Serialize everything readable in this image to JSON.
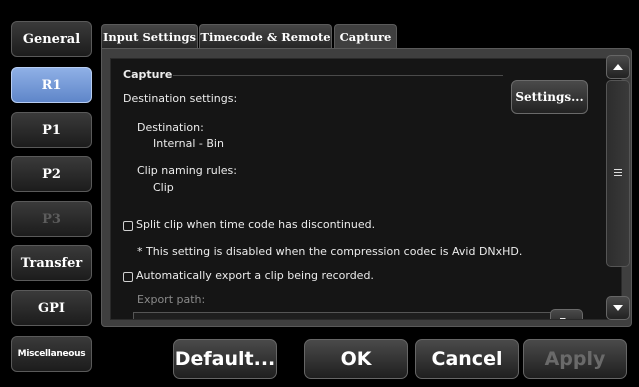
{
  "sidebar": {
    "items": [
      {
        "label": "General"
      },
      {
        "label": "R1"
      },
      {
        "label": "P1"
      },
      {
        "label": "P2"
      },
      {
        "label": "P3"
      },
      {
        "label": "Transfer"
      },
      {
        "label": "GPI"
      },
      {
        "label": "Miscellaneous"
      }
    ]
  },
  "tabs": [
    {
      "label": "Input Settings"
    },
    {
      "label": "Timecode & Remote"
    },
    {
      "label": "Capture"
    }
  ],
  "capture": {
    "group_title": "Capture",
    "destination_settings_label": "Destination settings:",
    "settings_button": "Settings...",
    "destination_label": "Destination:",
    "destination_value": "Internal - Bin",
    "clip_naming_label": "Clip naming rules:",
    "clip_naming_value": "Clip",
    "split_clip_label": "Split clip when time code has discontinued.",
    "split_clip_checked": false,
    "dnxhd_note": "* This setting is disabled when the compression codec is Avid DNxHD.",
    "auto_export_label": "Automatically export a clip being recorded.",
    "auto_export_checked": false,
    "export_path_label": "Export path:"
  },
  "footer": {
    "default_button": "Default...",
    "ok_button": "OK",
    "cancel_button": "Cancel",
    "apply_button": "Apply"
  },
  "colors": {
    "active_sidebar": "#7fa3df",
    "background": "#000000",
    "panel": "#3f3f3f",
    "content": "#151515"
  },
  "icons": {
    "scroll_up": "up-arrow-icon",
    "scroll_down": "down-arrow-icon",
    "scroll_grip": "grip-icon",
    "export_browse": "folder-icon"
  }
}
